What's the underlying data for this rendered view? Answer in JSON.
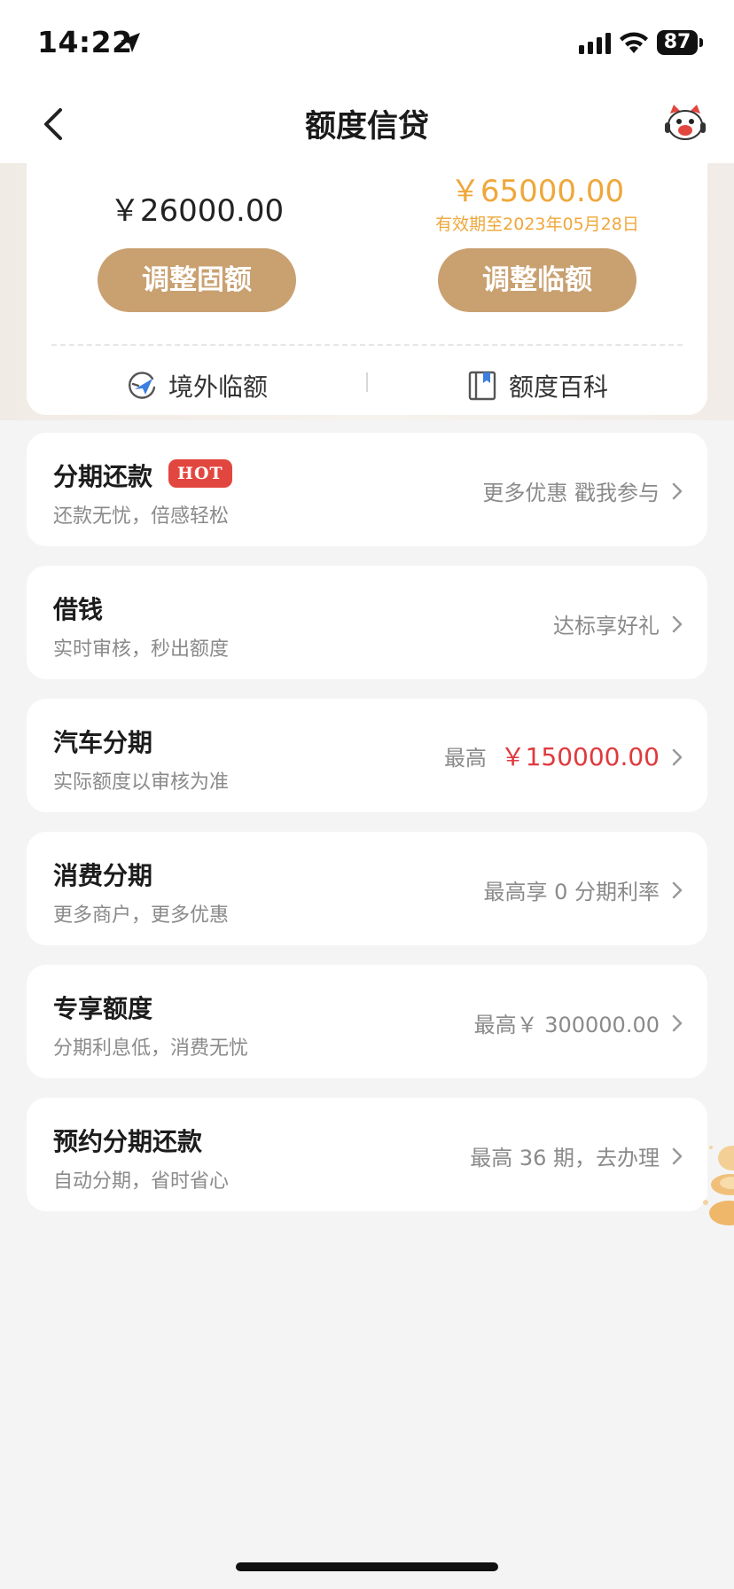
{
  "status_bar": {
    "time": "14:22",
    "battery": "87"
  },
  "header": {
    "title": "额度信贷"
  },
  "limit_card": {
    "fixed_amount": "￥26000.00",
    "temp_amount": "￥65000.00",
    "temp_validity": "有效期至2023年05月28日",
    "adjust_fixed_label": "调整固额",
    "adjust_temp_label": "调整临额",
    "links": [
      {
        "label": "境外临额",
        "icon": "plane-globe-icon"
      },
      {
        "label": "额度百科",
        "icon": "book-icon"
      }
    ]
  },
  "items": [
    {
      "title": "分期还款",
      "badge": "HOT",
      "subtitle": "还款无忧，倍感轻松",
      "right": "更多优惠 戳我参与"
    },
    {
      "title": "借钱",
      "subtitle": "实时审核，秒出额度",
      "right": "达标享好礼"
    },
    {
      "title": "汽车分期",
      "subtitle": "实际额度以审核为准",
      "right_prefix": "最高",
      "right_amount": "￥150000.00"
    },
    {
      "title": "消费分期",
      "subtitle": "更多商户，更多优惠",
      "right": "最高享 0 分期利率"
    },
    {
      "title": "专享额度",
      "subtitle": "分期利息低，消费无忧",
      "right": "最高￥ 300000.00"
    },
    {
      "title": "预约分期还款",
      "subtitle": "自动分期，省时省心",
      "right": "最高 36 期，去办理"
    }
  ],
  "colors": {
    "accent": "#c9a070",
    "gold_text": "#efa73a",
    "red": "#e0393e",
    "hot_badge": "#e2473f"
  }
}
